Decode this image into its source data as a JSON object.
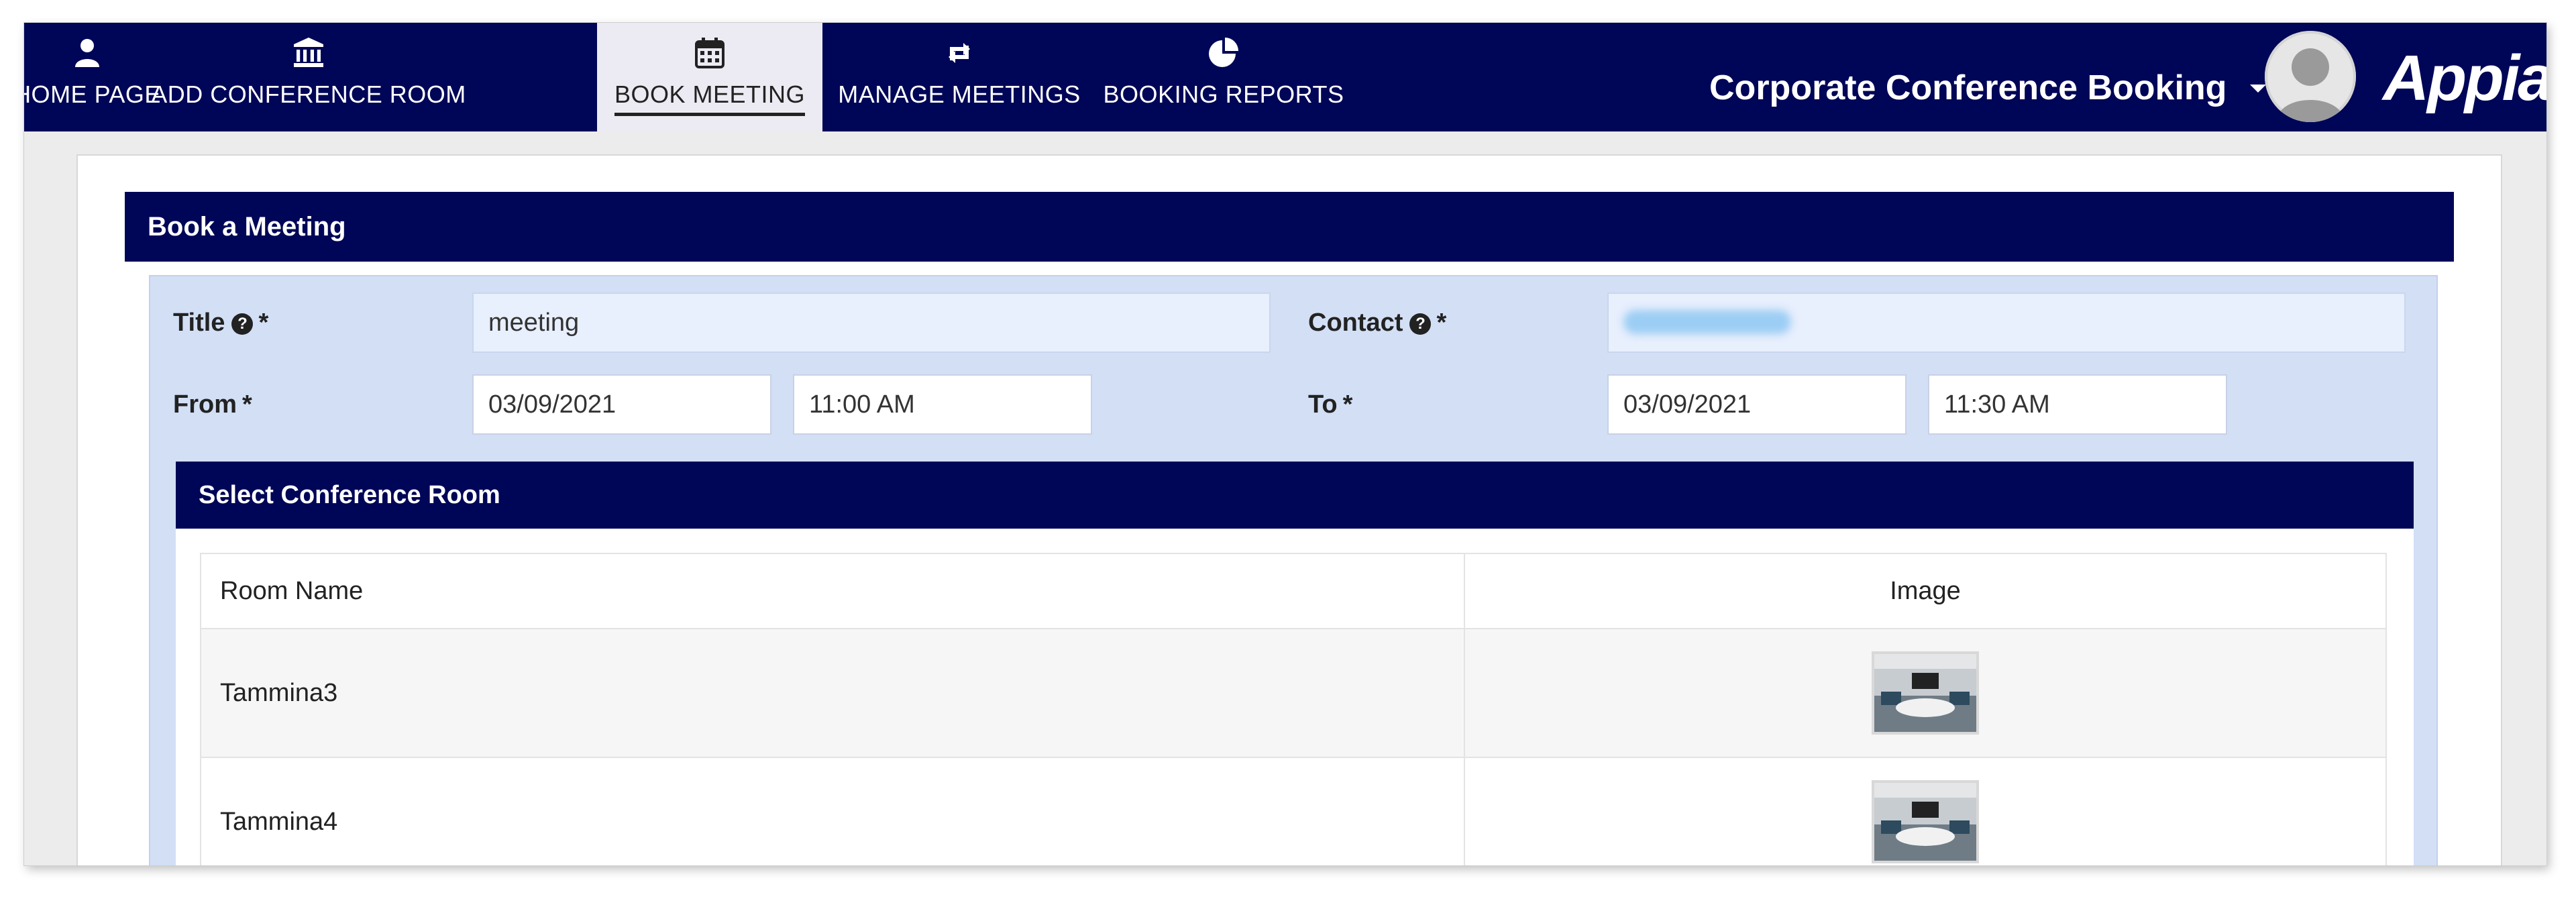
{
  "nav": {
    "tabs": [
      {
        "label": "HOME PAGE",
        "icon": "user-icon"
      },
      {
        "label": "ADD CONFERENCE ROOM",
        "icon": "bank-icon"
      },
      {
        "label": "BOOK MEETING",
        "icon": "calendar-icon",
        "active": true
      },
      {
        "label": "MANAGE MEETINGS",
        "icon": "retweet-icon"
      },
      {
        "label": "BOOKING REPORTS",
        "icon": "pie-chart-icon"
      }
    ],
    "app_name": "Corporate Conference Booking",
    "brand": "Appian",
    "bar_color": "#000657"
  },
  "form": {
    "heading": "Book a Meeting",
    "title_label": "Title",
    "title_value": "meeting",
    "contact_label": "Contact",
    "required_marker": "*",
    "help_glyph": "?",
    "from_label": "From",
    "from_date": "03/09/2021",
    "from_time": "11:00 AM",
    "to_label": "To",
    "to_date": "03/09/2021",
    "to_time": "11:30 AM"
  },
  "rooms": {
    "heading": "Select Conference Room",
    "columns": [
      "Room Name",
      "Image"
    ],
    "rows": [
      {
        "name": "Tammina3",
        "image": "conference-room-thumbnail"
      },
      {
        "name": "Tammina4",
        "image": "conference-room-thumbnail"
      }
    ]
  }
}
